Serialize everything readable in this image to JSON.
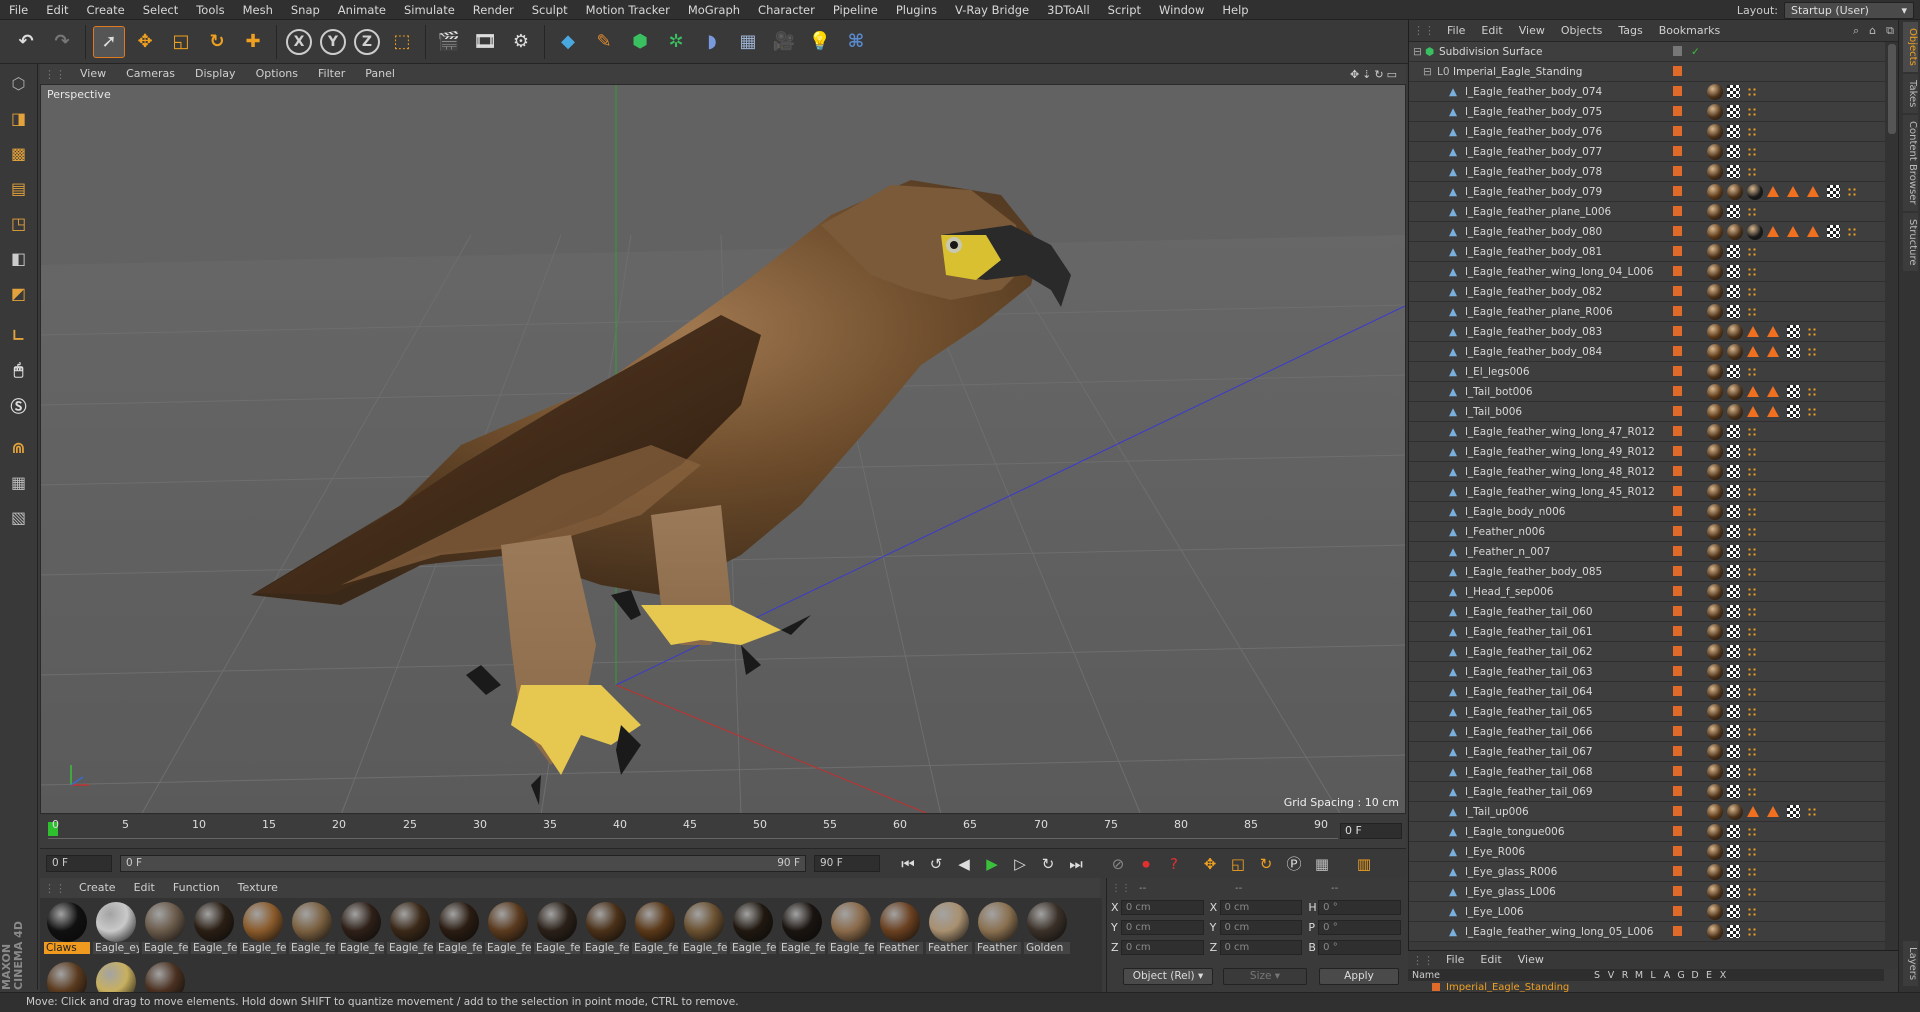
{
  "menu": [
    "File",
    "Edit",
    "Create",
    "Select",
    "Tools",
    "Mesh",
    "Snap",
    "Animate",
    "Simulate",
    "Render",
    "Sculpt",
    "Motion Tracker",
    "MoGraph",
    "Character",
    "Pipeline",
    "Plugins",
    "V-Ray Bridge",
    "3DToAll",
    "Script",
    "Window",
    "Help"
  ],
  "layout": {
    "label": "Layout:",
    "value": "Startup (User)"
  },
  "toolbar": {
    "x": "X",
    "y": "Y",
    "z": "Z"
  },
  "viewport": {
    "menu": [
      "View",
      "Cameras",
      "Display",
      "Options",
      "Filter",
      "Panel"
    ],
    "label": "Perspective",
    "grid_spacing": "Grid Spacing : 10 cm"
  },
  "timeline": {
    "ticks": [
      "0",
      "5",
      "10",
      "15",
      "20",
      "25",
      "30",
      "35",
      "40",
      "45",
      "50",
      "55",
      "60",
      "65",
      "70",
      "75",
      "80",
      "85",
      "90"
    ],
    "frame_display": "0 F",
    "start": "0 F",
    "slider_start": "0 F",
    "slider_end": "90 F",
    "end": "90 F"
  },
  "materials": {
    "menu": [
      "Create",
      "Edit",
      "Function",
      "Texture"
    ],
    "items": [
      {
        "name": "Claws",
        "color": "#101010",
        "selected": true
      },
      {
        "name": "Eagle_ey",
        "color": "#c9c9c9"
      },
      {
        "name": "Eagle_fe",
        "color": "#6a5a4a"
      },
      {
        "name": "Eagle_fe",
        "color": "#2a1e14"
      },
      {
        "name": "Eagle_fe",
        "color": "#8a5a2a"
      },
      {
        "name": "Eagle_fe",
        "color": "#7a6040"
      },
      {
        "name": "Eagle_fe",
        "color": "#2e2018"
      },
      {
        "name": "Eagle_fe",
        "color": "#3a2818"
      },
      {
        "name": "Eagle_fe",
        "color": "#2a1c12"
      },
      {
        "name": "Eagle_fe",
        "color": "#5a3a1e"
      },
      {
        "name": "Eagle_fe",
        "color": "#2a2018"
      },
      {
        "name": "Eagle_fe",
        "color": "#4a3018"
      },
      {
        "name": "Eagle_fe",
        "color": "#5a3818"
      },
      {
        "name": "Eagle_fe",
        "color": "#6a5030"
      },
      {
        "name": "Eagle_fe",
        "color": "#201810"
      },
      {
        "name": "Eagle_fe",
        "color": "#1a1410"
      },
      {
        "name": "Eagle_fe",
        "color": "#8a6a4a"
      },
      {
        "name": "Feather",
        "color": "#6a4020"
      },
      {
        "name": "Feather",
        "color": "#a89070"
      },
      {
        "name": "Feather",
        "color": "#8a7050"
      },
      {
        "name": "Golden",
        "color": "#3a3028"
      },
      {
        "name": "",
        "color": "#5a3a1e"
      },
      {
        "name": "",
        "color": "#c8b060"
      },
      {
        "name": "",
        "color": "#4a3020"
      }
    ]
  },
  "coords": {
    "rows": [
      {
        "a": "X",
        "av": "0 cm",
        "b": "X",
        "bv": "0 cm",
        "c": "H",
        "cv": "0 °"
      },
      {
        "a": "Y",
        "av": "0 cm",
        "b": "Y",
        "bv": "0 cm",
        "c": "P",
        "cv": "0 °"
      },
      {
        "a": "Z",
        "av": "0 cm",
        "b": "Z",
        "bv": "0 cm",
        "c": "B",
        "cv": "0 °"
      }
    ],
    "header_a": "--",
    "header_b": "--",
    "header_c": "--",
    "mode": "Object (Rel)",
    "size": "Size",
    "apply": "Apply"
  },
  "objects": {
    "menu": [
      "File",
      "Edit",
      "View",
      "Objects",
      "Tags",
      "Bookmarks"
    ],
    "root": "Subdivision Surface",
    "group": "Imperial_Eagle_Standing",
    "items": [
      {
        "name": "l_Eagle_feather_body_074",
        "t": "A"
      },
      {
        "name": "l_Eagle_feather_body_075",
        "t": "A"
      },
      {
        "name": "l_Eagle_feather_body_076",
        "t": "A"
      },
      {
        "name": "l_Eagle_feather_body_077",
        "t": "A"
      },
      {
        "name": "l_Eagle_feather_body_078",
        "t": "A"
      },
      {
        "name": "l_Eagle_feather_body_079",
        "t": "C"
      },
      {
        "name": "l_Eagle_feather_plane_L006",
        "t": "A"
      },
      {
        "name": "l_Eagle_feather_body_080",
        "t": "C"
      },
      {
        "name": "l_Eagle_feather_body_081",
        "t": "A"
      },
      {
        "name": "l_Eagle_feather_wing_long_04_L006",
        "t": "A"
      },
      {
        "name": "l_Eagle_feather_body_082",
        "t": "A"
      },
      {
        "name": "l_Eagle_feather_plane_R006",
        "t": "A"
      },
      {
        "name": "l_Eagle_feather_body_083",
        "t": "B"
      },
      {
        "name": "l_Eagle_feather_body_084",
        "t": "B"
      },
      {
        "name": "l_El_legs006",
        "t": "A"
      },
      {
        "name": "l_Tail_bot006",
        "t": "B"
      },
      {
        "name": "l_Tail_b006",
        "t": "B"
      },
      {
        "name": "l_Eagle_feather_wing_long_47_R012",
        "t": "A"
      },
      {
        "name": "l_Eagle_feather_wing_long_49_R012",
        "t": "A"
      },
      {
        "name": "l_Eagle_feather_wing_long_48_R012",
        "t": "A"
      },
      {
        "name": "l_Eagle_feather_wing_long_45_R012",
        "t": "A"
      },
      {
        "name": "l_Eagle_body_n006",
        "t": "A"
      },
      {
        "name": "l_Feather_n006",
        "t": "A"
      },
      {
        "name": "l_Feather_n_007",
        "t": "A"
      },
      {
        "name": "l_Eagle_feather_body_085",
        "t": "A"
      },
      {
        "name": "l_Head_f_sep006",
        "t": "A"
      },
      {
        "name": "l_Eagle_feather_tail_060",
        "t": "A"
      },
      {
        "name": "l_Eagle_feather_tail_061",
        "t": "A"
      },
      {
        "name": "l_Eagle_feather_tail_062",
        "t": "A"
      },
      {
        "name": "l_Eagle_feather_tail_063",
        "t": "A"
      },
      {
        "name": "l_Eagle_feather_tail_064",
        "t": "A"
      },
      {
        "name": "l_Eagle_feather_tail_065",
        "t": "A"
      },
      {
        "name": "l_Eagle_feather_tail_066",
        "t": "A"
      },
      {
        "name": "l_Eagle_feather_tail_067",
        "t": "A"
      },
      {
        "name": "l_Eagle_feather_tail_068",
        "t": "A"
      },
      {
        "name": "l_Eagle_feather_tail_069",
        "t": "A"
      },
      {
        "name": "l_Tail_up006",
        "t": "B"
      },
      {
        "name": "l_Eagle_tongue006",
        "t": "A"
      },
      {
        "name": "l_Eye_R006",
        "t": "A"
      },
      {
        "name": "l_Eye_glass_R006",
        "t": "A"
      },
      {
        "name": "l_Eye_glass_L006",
        "t": "A"
      },
      {
        "name": "l_Eye_L006",
        "t": "A"
      },
      {
        "name": "l_Eagle_feather_wing_long_05_L006",
        "t": "A"
      }
    ]
  },
  "attributes": {
    "menu": [
      "File",
      "Edit",
      "View"
    ],
    "columns": [
      "Name",
      "S",
      "V",
      "R",
      "M",
      "L",
      "A",
      "G",
      "D",
      "E",
      "X"
    ],
    "row": "Imperial_Eagle_Standing"
  },
  "side_tabs": [
    "Objects",
    "Takes",
    "Content Browser",
    "Structure"
  ],
  "side_tab_bottom": "Layers",
  "brand": "MAXON CINEMA 4D",
  "status": "Move: Click and drag to move elements. Hold down SHIFT to quantize movement / add to the selection in point mode, CTRL to remove."
}
